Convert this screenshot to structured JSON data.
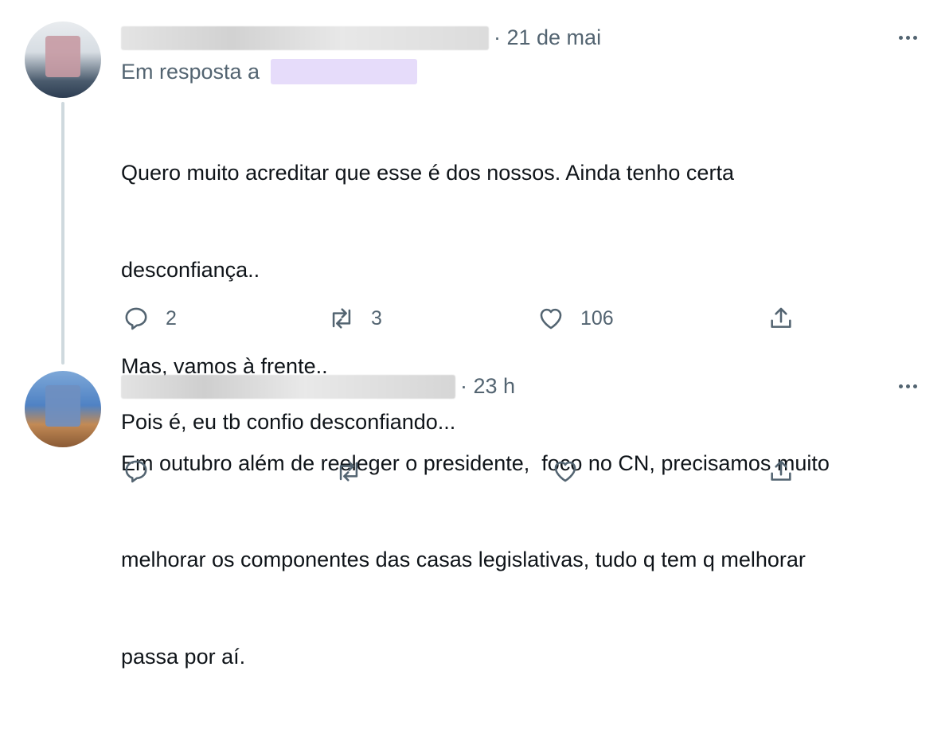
{
  "tweet1": {
    "timestamp": "· 21 de mai",
    "reply_prefix": "Em resposta a",
    "lines": [
      "Quero muito acreditar que esse é dos nossos. Ainda tenho certa",
      "desconfiança..",
      "Mas, vamos à frente..",
      "Em outubro além de reeleger o presidente,  foco no CN, precisamos muito",
      "melhorar os componentes das casas legislativas, tudo q tem q melhorar",
      "passa por aí."
    ],
    "replies": "2",
    "retweets": "3",
    "likes": "106"
  },
  "tweet2": {
    "timestamp": "· 23 h",
    "text": "Pois é, eu tb confio desconfiando..."
  },
  "icons": {
    "reply": "reply-icon",
    "retweet": "retweet-icon",
    "like": "heart-icon",
    "share": "share-icon",
    "more": "more-icon"
  },
  "colors": {
    "muted": "#536471",
    "text": "#0f1419",
    "thread": "#cfd9de"
  }
}
